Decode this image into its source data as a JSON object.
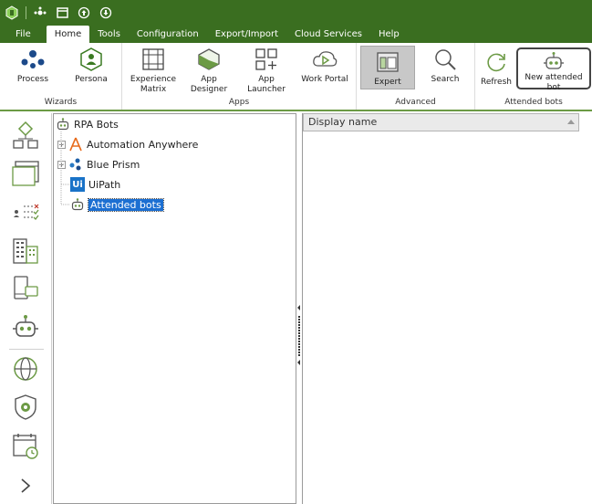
{
  "menu": {
    "tabs": [
      "File",
      "Home",
      "Tools",
      "Configuration",
      "Export/Import",
      "Cloud Services",
      "Help"
    ],
    "active": "Home"
  },
  "ribbon": {
    "wizards": {
      "label": "Wizards",
      "process": "Process",
      "persona": "Persona"
    },
    "apps": {
      "label": "Apps",
      "experience_matrix_line1": "Experience",
      "experience_matrix_line2": "Matrix",
      "app_designer": "App Designer",
      "app_launcher": "App Launcher",
      "work_portal": "Work Portal"
    },
    "advanced": {
      "label": "Advanced",
      "expert": "Expert",
      "search": "Search"
    },
    "attended": {
      "label": "Attended bots",
      "refresh": "Refresh",
      "new_attended_bot": "New attended bot"
    }
  },
  "tree": {
    "root": "RPA Bots",
    "items": [
      {
        "label": "Automation Anywhere",
        "expandable": true
      },
      {
        "label": "Blue Prism",
        "expandable": true
      },
      {
        "label": "UiPath",
        "expandable": false
      },
      {
        "label": "Attended bots",
        "expandable": false,
        "selected": true
      }
    ]
  },
  "grid": {
    "column": "Display name"
  },
  "colors": {
    "brand": "#3a6e20",
    "accent": "#6c9a45",
    "selection": "#1c6fd2"
  }
}
